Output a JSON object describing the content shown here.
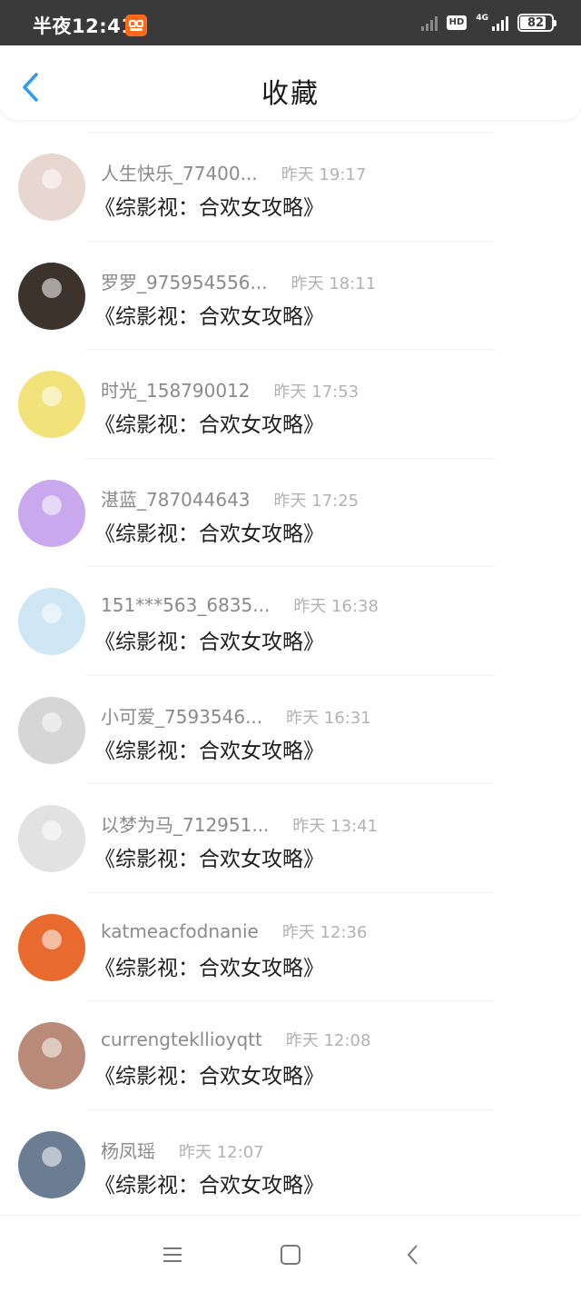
{
  "status_bar": {
    "time": "半夜12:41",
    "network": "4G",
    "hd_badge": "HD",
    "battery_percent": "82",
    "battery_level": 0.82,
    "app_icon": "app-notification-icon"
  },
  "header": {
    "title": "收藏",
    "back_icon": "chevron-left-icon",
    "accent_color": "#2d9cf0"
  },
  "list": [
    {
      "user": "人生快乐_77400...",
      "time": "昨天 19:17",
      "title": "《综影视：合欢女攻略》",
      "avatar_color": "#e8d6d0"
    },
    {
      "user": "罗罗_975954556...",
      "time": "昨天 18:11",
      "title": "《综影视：合欢女攻略》",
      "avatar_color": "#3c342c"
    },
    {
      "user": "时光_158790012",
      "time": "昨天 17:53",
      "title": "《综影视：合欢女攻略》",
      "avatar_color": "#f2e27a"
    },
    {
      "user": "湛蓝_787044643",
      "time": "昨天 17:25",
      "title": "《综影视：合欢女攻略》",
      "avatar_color": "#c9a8ee"
    },
    {
      "user": "151***563_6835...",
      "time": "昨天 16:38",
      "title": "《综影视：合欢女攻略》",
      "avatar_color": "#cfe6f5"
    },
    {
      "user": "小可爱_7593546...",
      "time": "昨天 16:31",
      "title": "《综影视：合欢女攻略》",
      "avatar_color": "#d6d6d6"
    },
    {
      "user": "以梦为马_712951...",
      "time": "昨天 13:41",
      "title": "《综影视：合欢女攻略》",
      "avatar_color": "#e2e2e2"
    },
    {
      "user": "katmeacfodnanie",
      "time": "昨天 12:36",
      "title": "《综影视：合欢女攻略》",
      "avatar_color": "#e86a2e"
    },
    {
      "user": "currengtekllioyqtt",
      "time": "昨天 12:08",
      "title": "《综影视：合欢女攻略》",
      "avatar_color": "#b98a78"
    },
    {
      "user": "杨凤瑶",
      "time": "昨天 12:07",
      "title": "《综影视：合欢女攻略》",
      "avatar_color": "#6b7d93"
    }
  ],
  "nav_bar": {
    "menu_icon": "menu-icon",
    "home_icon": "home-square-icon",
    "back_icon": "back-triangle-icon"
  }
}
